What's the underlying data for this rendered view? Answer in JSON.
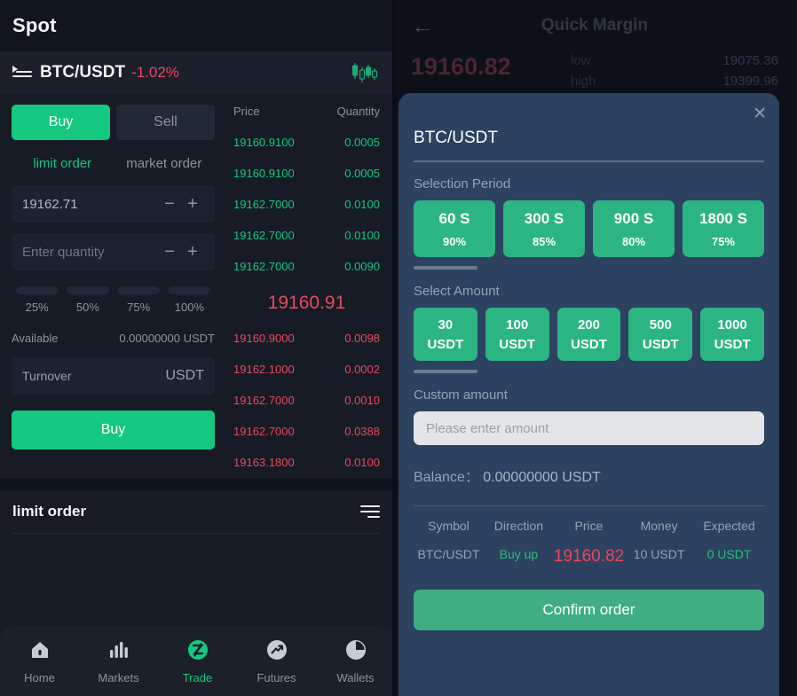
{
  "left": {
    "spot_title": "Spot",
    "pair": {
      "name": "BTC/USDT",
      "change": "-1.02%",
      "list_icon": "list-icon",
      "candle_icon": "candlestick-icon"
    },
    "side_tabs": {
      "buy": "Buy",
      "sell": "Sell"
    },
    "order_types": {
      "limit": "limit order",
      "market": "market order"
    },
    "price_input": {
      "value": "19162.71",
      "minus": "−",
      "plus": "+"
    },
    "quantity_input": {
      "placeholder": "Enter quantity",
      "minus": "−",
      "plus": "+"
    },
    "percents": [
      "25%",
      "50%",
      "75%",
      "100%"
    ],
    "available": {
      "label": "Available",
      "value": "0.00000000 USDT"
    },
    "turnover": {
      "label": "Turnover",
      "unit": "USDT"
    },
    "submit_label": "Buy",
    "orderbook": {
      "header": {
        "price": "Price",
        "quantity": "Quantity"
      },
      "asks": [
        {
          "price": "19160.9100",
          "qty": "0.0005"
        },
        {
          "price": "19160.9100",
          "qty": "0.0005"
        },
        {
          "price": "19162.7000",
          "qty": "0.0100"
        },
        {
          "price": "19162.7000",
          "qty": "0.0100"
        },
        {
          "price": "19162.7000",
          "qty": "0.0090"
        }
      ],
      "last_price": "19160.91",
      "bids": [
        {
          "price": "19160.9000",
          "qty": "0.0098"
        },
        {
          "price": "19162.1000",
          "qty": "0.0002"
        },
        {
          "price": "19162.7000",
          "qty": "0.0010"
        },
        {
          "price": "19162.7000",
          "qty": "0.0388"
        },
        {
          "price": "19163.1800",
          "qty": "0.0100"
        }
      ]
    },
    "limit_section": {
      "title": "limit order",
      "filter_icon": "filter-icon"
    },
    "tabbar": [
      {
        "label": "Home",
        "icon": "home-icon",
        "active": false
      },
      {
        "label": "Markets",
        "icon": "bar-chart-icon",
        "active": false
      },
      {
        "label": "Trade",
        "icon": "trade-icon",
        "active": true
      },
      {
        "label": "Futures",
        "icon": "trend-up-icon",
        "active": false
      },
      {
        "label": "Wallets",
        "icon": "pie-chart-icon",
        "active": false
      }
    ]
  },
  "right": {
    "background": {
      "back_icon": "back-arrow-icon",
      "title": "Quick Margin",
      "price": "19160.82",
      "stats": [
        {
          "k": "low",
          "v": "19075.36"
        },
        {
          "k": "high",
          "v": "19399.96"
        }
      ]
    },
    "modal": {
      "close_icon": "close-icon",
      "pair": "BTC/USDT",
      "period_label": "Selection Period",
      "periods": [
        {
          "time": "60 S",
          "rate": "90%"
        },
        {
          "time": "300 S",
          "rate": "85%"
        },
        {
          "time": "900 S",
          "rate": "80%"
        },
        {
          "time": "1800 S",
          "rate": "75%"
        }
      ],
      "amount_label": "Select Amount",
      "amounts": [
        {
          "value": "30",
          "unit": "USDT"
        },
        {
          "value": "100",
          "unit": "USDT"
        },
        {
          "value": "200",
          "unit": "USDT"
        },
        {
          "value": "500",
          "unit": "USDT"
        },
        {
          "value": "1000",
          "unit": "USDT"
        }
      ],
      "custom_label": "Custom amount",
      "custom_placeholder": "Please enter amount",
      "balance_label": "Balance：",
      "balance_value": "0.00000000 USDT",
      "summary_headers": [
        "Symbol",
        "Direction",
        "Price",
        "Money",
        "Expected"
      ],
      "summary_values": {
        "symbol": "BTC/USDT",
        "direction": "Buy up",
        "price": "19160.82",
        "money": "10 USDT",
        "expected": "0 USDT"
      },
      "confirm_label": "Confirm order"
    }
  },
  "colors": {
    "green": "#14c97f",
    "red": "#e8485f",
    "modal_bg": "#2d4160",
    "chip_green": "#2bb583"
  }
}
